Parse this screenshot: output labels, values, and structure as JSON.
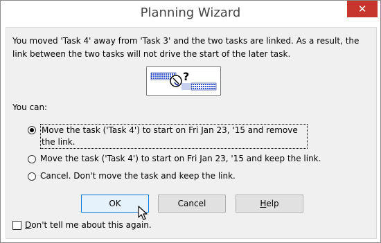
{
  "window": {
    "title": "Planning Wizard",
    "close_glyph": "✕"
  },
  "message": "You moved 'Task 4' away from 'Task 3' and the two tasks are linked.  As a result, the link between the two tasks will not drive the start of the later task.",
  "you_can_label": "You can:",
  "options": [
    {
      "label": "Move the task ('Task 4') to start on Fri Jan 23, '15 and remove the link.",
      "selected": true
    },
    {
      "label": "Move the task ('Task 4') to start on Fri Jan 23, '15 and keep the link.",
      "selected": false
    },
    {
      "label": "Cancel.  Don't move the task and keep the link.",
      "selected": false
    }
  ],
  "buttons": {
    "ok": "OK",
    "cancel": "Cancel",
    "help_prefix": "",
    "help_mnemonic": "H",
    "help_suffix": "elp"
  },
  "dont_tell": {
    "mnemonic": "D",
    "rest": "on't tell me about this again.",
    "checked": false
  },
  "colors": {
    "close_bg": "#c7362c",
    "graphic_blue": "#3355cc"
  },
  "icons": {
    "close": "close-icon",
    "graphic": "task-link-question-icon",
    "cursor": "mouse-cursor-icon"
  }
}
